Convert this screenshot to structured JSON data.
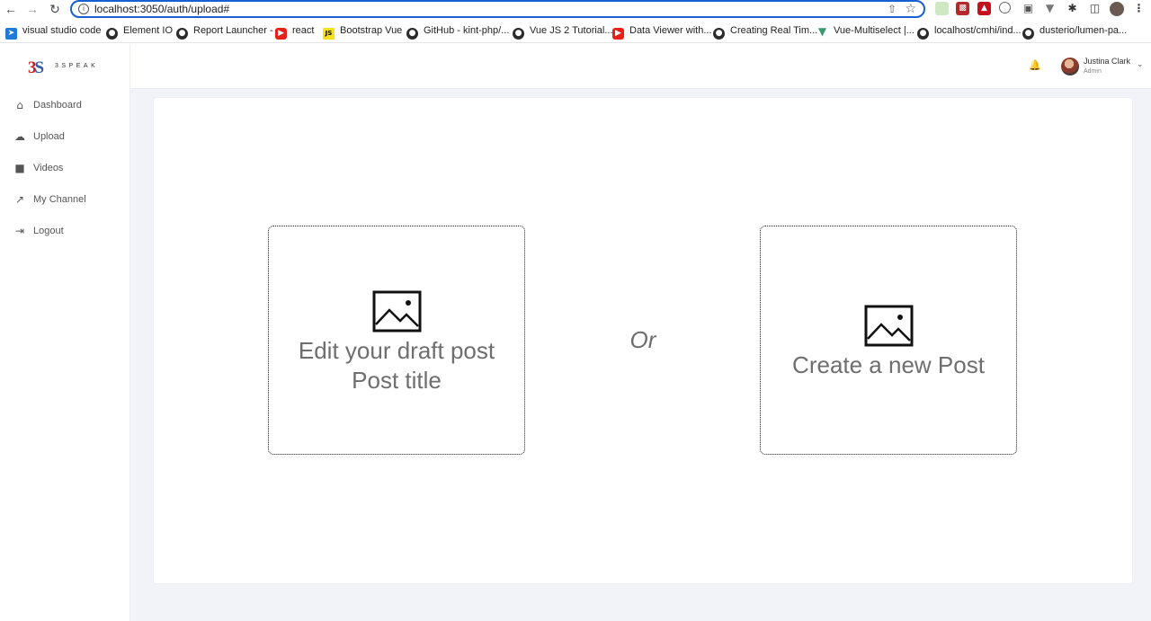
{
  "browser": {
    "url": "localhost:3050/auth/upload#",
    "bookmarks": [
      {
        "label": "visual studio code",
        "icon": "vscode-icon"
      },
      {
        "label": "Element IO",
        "icon": "github-icon"
      },
      {
        "label": "Report Launcher -",
        "icon": "github-icon"
      },
      {
        "label": "react",
        "icon": "youtube-icon"
      },
      {
        "label": "Bootstrap Vue",
        "icon": "js-icon"
      },
      {
        "label": "GitHub - kint-php/...",
        "icon": "github-icon"
      },
      {
        "label": "Vue JS 2 Tutorial...",
        "icon": "github-icon"
      },
      {
        "label": "Data Viewer with...",
        "icon": "youtube-icon"
      },
      {
        "label": "Creating Real Tim...",
        "icon": "github-icon"
      },
      {
        "label": "Vue-Multiselect |...",
        "icon": "vue-icon"
      },
      {
        "label": "localhost/cmhi/ind...",
        "icon": "github-icon"
      },
      {
        "label": "dusterio/lumen-pa...",
        "icon": "github-icon"
      }
    ]
  },
  "brand": {
    "mark": "3S",
    "wordmark": "3SPEAK",
    "accent_red": "#c52127",
    "accent_blue": "#2e5aa7"
  },
  "sidebar": {
    "items": [
      {
        "label": "Dashboard",
        "icon": "home-icon"
      },
      {
        "label": "Upload",
        "icon": "cloud-upload-icon"
      },
      {
        "label": "Videos",
        "icon": "video-icon"
      },
      {
        "label": "My Channel",
        "icon": "external-link-icon"
      },
      {
        "label": "Logout",
        "icon": "logout-icon"
      }
    ]
  },
  "header": {
    "user": {
      "name": "Justina Clark",
      "role": "Admin"
    }
  },
  "main": {
    "edit_draft": {
      "line1": "Edit your draft post",
      "line2": "Post title"
    },
    "separator": "Or",
    "create_new": {
      "label": "Create a new Post"
    }
  }
}
